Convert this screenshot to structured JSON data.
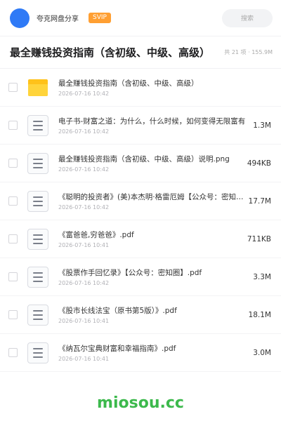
{
  "header": {
    "brand": "夸克网盘分享",
    "badge": "SVIP",
    "search_placeholder": "搜索"
  },
  "folder": {
    "title": "最全赚钱投资指南（含初级、中级、高级）",
    "count": "共 21 项 · 155.9M"
  },
  "files": [
    {
      "name": "最全赚钱投资指南（含初级、中级、高级）",
      "date": "2026-07-16 10:42",
      "size": "",
      "type": "folder"
    },
    {
      "name": "电子书-财富之道：为什么，什么时候，如何变得无限富有",
      "date": "2026-07-16 10:42",
      "size": "1.3M",
      "type": "doc"
    },
    {
      "name": "最全赚钱投资指南（含初级、中级、高级）说明.png",
      "date": "2026-07-16 10:42",
      "size": "494KB",
      "type": "doc"
    },
    {
      "name": "《聪明的投资者》(美)本杰明·格雷厄姆【公众号：密知圈】",
      "date": "2026-07-16 10:42",
      "size": "17.7M",
      "type": "doc"
    },
    {
      "name": "《富爸爸,穷爸爸》.pdf",
      "date": "2026-07-16 10:41",
      "size": "711KB",
      "type": "doc"
    },
    {
      "name": "《股票作手回忆录》【公众号：密知圈】.pdf",
      "date": "2026-07-16 10:42",
      "size": "3.3M",
      "type": "doc"
    },
    {
      "name": "《股市长线法宝（原书第5版）》.pdf",
      "date": "2026-07-16 10:41",
      "size": "18.1M",
      "type": "doc"
    },
    {
      "name": "《纳瓦尔宝典财富和幸福指南》.pdf",
      "date": "2026-07-16 10:41",
      "size": "3.0M",
      "type": "doc"
    }
  ],
  "watermark": "miosou.cc",
  "colors": {
    "accent": "#2f7af6",
    "badge": "#ff9f32",
    "watermark": "#3cb94c",
    "folder": "#ffc21a"
  }
}
